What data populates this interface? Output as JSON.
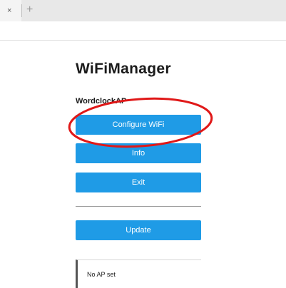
{
  "browser": {
    "tab_close": "×",
    "new_tab": "+"
  },
  "manager": {
    "title": "WiFiManager",
    "subtitle": "WordclockAP",
    "buttons": {
      "configure": "Configure WiFi",
      "info": "Info",
      "exit": "Exit",
      "update": "Update"
    },
    "status": "No AP set"
  },
  "colors": {
    "button_blue": "#1f9be6",
    "annotation_red": "#e01818"
  },
  "icons": {
    "tab_close": "close-icon",
    "new_tab": "plus-icon"
  }
}
